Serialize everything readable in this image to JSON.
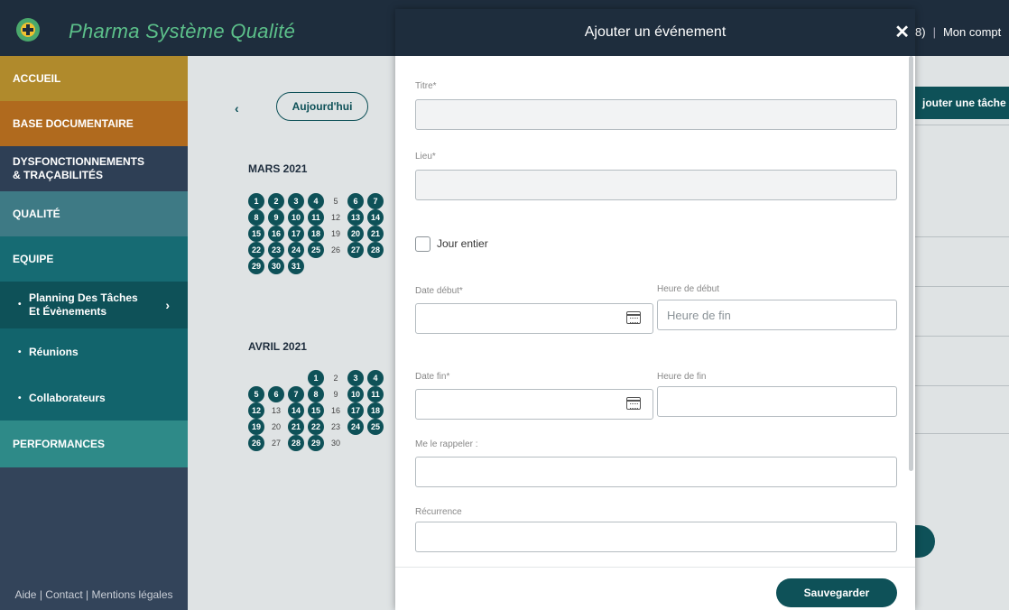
{
  "header": {
    "app_title": "Pharma Système Qualité",
    "right_partial": "8)",
    "account": "Mon compt"
  },
  "sidebar": {
    "accueil": "ACCUEIL",
    "base": "BASE DOCUMENTAIRE",
    "dysf_line1": "DYSFONCTIONNEMENTS",
    "dysf_line2": "& TRAÇABILITÉS",
    "qualite": "QUALITÉ",
    "equipe": "EQUIPE",
    "planning_line1": "Planning Des Tâches",
    "planning_line2": "Et Évènements",
    "reunions": "Réunions",
    "collaborateurs": "Collaborateurs",
    "performances": "PERFORMANCES",
    "footer": {
      "aide": "Aide",
      "contact": "Contact",
      "mentions": "Mentions légales",
      "sep": "|"
    }
  },
  "calendar": {
    "prev": "‹",
    "today": "Aujourd'hui",
    "add_task": "jouter une tâche",
    "march_label": "MARS 2021",
    "april_label": "AVRIL 2021",
    "march_days": [
      {
        "d": "1",
        "busy": true
      },
      {
        "d": "2",
        "busy": true
      },
      {
        "d": "3",
        "busy": true
      },
      {
        "d": "4",
        "busy": true
      },
      {
        "d": "5",
        "busy": false
      },
      {
        "d": "6",
        "busy": true
      },
      {
        "d": "7",
        "busy": true
      },
      {
        "d": "8",
        "busy": true
      },
      {
        "d": "9",
        "busy": true
      },
      {
        "d": "10",
        "busy": true
      },
      {
        "d": "11",
        "busy": true
      },
      {
        "d": "12",
        "busy": false
      },
      {
        "d": "13",
        "busy": true
      },
      {
        "d": "14",
        "busy": true
      },
      {
        "d": "15",
        "busy": true
      },
      {
        "d": "16",
        "busy": true
      },
      {
        "d": "17",
        "busy": true
      },
      {
        "d": "18",
        "busy": true
      },
      {
        "d": "19",
        "busy": false
      },
      {
        "d": "20",
        "busy": true
      },
      {
        "d": "21",
        "busy": true
      },
      {
        "d": "22",
        "busy": true
      },
      {
        "d": "23",
        "busy": true
      },
      {
        "d": "24",
        "busy": true
      },
      {
        "d": "25",
        "busy": true
      },
      {
        "d": "26",
        "busy": false
      },
      {
        "d": "27",
        "busy": true
      },
      {
        "d": "28",
        "busy": true
      },
      {
        "d": "29",
        "busy": true
      },
      {
        "d": "30",
        "busy": true
      },
      {
        "d": "31",
        "busy": true
      }
    ],
    "april_days": [
      {
        "d": "",
        "busy": false
      },
      {
        "d": "",
        "busy": false
      },
      {
        "d": "",
        "busy": false
      },
      {
        "d": "1",
        "busy": true
      },
      {
        "d": "2",
        "busy": false
      },
      {
        "d": "3",
        "busy": true
      },
      {
        "d": "4",
        "busy": true
      },
      {
        "d": "5",
        "busy": true
      },
      {
        "d": "6",
        "busy": true
      },
      {
        "d": "7",
        "busy": true
      },
      {
        "d": "8",
        "busy": true
      },
      {
        "d": "9",
        "busy": false
      },
      {
        "d": "10",
        "busy": true
      },
      {
        "d": "11",
        "busy": true
      },
      {
        "d": "12",
        "busy": true
      },
      {
        "d": "13",
        "busy": false
      },
      {
        "d": "14",
        "busy": true
      },
      {
        "d": "15",
        "busy": true
      },
      {
        "d": "16",
        "busy": false
      },
      {
        "d": "17",
        "busy": true
      },
      {
        "d": "18",
        "busy": true
      },
      {
        "d": "19",
        "busy": true
      },
      {
        "d": "20",
        "busy": false
      },
      {
        "d": "21",
        "busy": true
      },
      {
        "d": "22",
        "busy": true
      },
      {
        "d": "23",
        "busy": false
      },
      {
        "d": "24",
        "busy": true
      },
      {
        "d": "25",
        "busy": true
      },
      {
        "d": "26",
        "busy": true
      },
      {
        "d": "27",
        "busy": false
      },
      {
        "d": "28",
        "busy": true
      },
      {
        "d": "29",
        "busy": true
      },
      {
        "d": "30",
        "busy": false
      }
    ]
  },
  "modal": {
    "title": "Ajouter un événement",
    "close": "✕",
    "titre_label": "Titre*",
    "titre_value": "",
    "lieu_label": "Lieu*",
    "lieu_value": "",
    "jour_entier_label": "Jour entier",
    "date_debut_label": "Date début*",
    "heure_debut_label": "Heure de début",
    "heure_debut_placeholder": "Heure de fin",
    "date_fin_label": "Date fin*",
    "heure_fin_label": "Heure de fin",
    "rappel_label": "Me le rappeler :",
    "recurrence_label": "Récurrence",
    "save": "Sauvegarder"
  },
  "colors": {
    "primary": "#0e5158",
    "topbar": "#1e2d3d",
    "brand_green": "#5cc08a"
  }
}
